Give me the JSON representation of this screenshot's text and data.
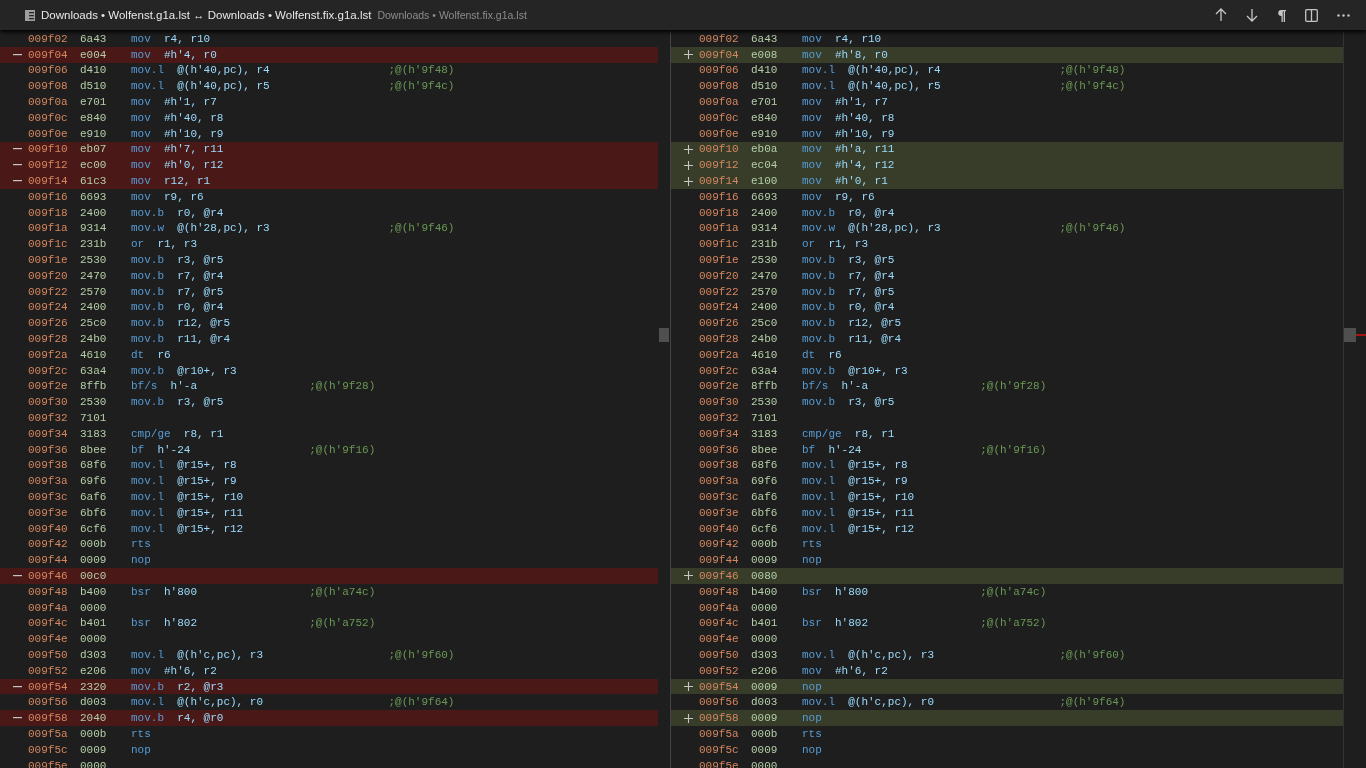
{
  "title": {
    "name": "Downloads • Wolfenst.g1a.lst ↔ Downloads • Wolfenst.fix.g1a.lst",
    "description": "Downloads • Wolfenst.fix.g1a.lst"
  },
  "panes": [
    {
      "lines": [
        {
          "kind": "unchanged",
          "addr": "009f02",
          "opcode": "6a43",
          "mnemonic": "mov",
          "operands": "r4, r10"
        },
        {
          "kind": "removed",
          "addr": "009f04",
          "opcode": "e004",
          "mnemonic": "mov",
          "operands": "#h'4, r0"
        },
        {
          "kind": "unchanged",
          "addr": "009f06",
          "opcode": "d410",
          "mnemonic": "mov.l",
          "operands": "@(h'40,pc), r4",
          "comment": ";@(h'9f48)"
        },
        {
          "kind": "unchanged",
          "addr": "009f08",
          "opcode": "d510",
          "mnemonic": "mov.l",
          "operands": "@(h'40,pc), r5",
          "comment": ";@(h'9f4c)"
        },
        {
          "kind": "unchanged",
          "addr": "009f0a",
          "opcode": "e701",
          "mnemonic": "mov",
          "operands": "#h'1, r7"
        },
        {
          "kind": "unchanged",
          "addr": "009f0c",
          "opcode": "e840",
          "mnemonic": "mov",
          "operands": "#h'40, r8"
        },
        {
          "kind": "unchanged",
          "addr": "009f0e",
          "opcode": "e910",
          "mnemonic": "mov",
          "operands": "#h'10, r9"
        },
        {
          "kind": "removed",
          "addr": "009f10",
          "opcode": "eb07",
          "mnemonic": "mov",
          "operands": "#h'7, r11"
        },
        {
          "kind": "removed",
          "addr": "009f12",
          "opcode": "ec00",
          "mnemonic": "mov",
          "operands": "#h'0, r12"
        },
        {
          "kind": "removed",
          "addr": "009f14",
          "opcode": "61c3",
          "mnemonic": "mov",
          "operands": "r12, r1"
        },
        {
          "kind": "unchanged",
          "addr": "009f16",
          "opcode": "6693",
          "mnemonic": "mov",
          "operands": "r9, r6"
        },
        {
          "kind": "unchanged",
          "addr": "009f18",
          "opcode": "2400",
          "mnemonic": "mov.b",
          "operands": "r0, @r4"
        },
        {
          "kind": "unchanged",
          "addr": "009f1a",
          "opcode": "9314",
          "mnemonic": "mov.w",
          "operands": "@(h'28,pc), r3",
          "comment": ";@(h'9f46)"
        },
        {
          "kind": "unchanged",
          "addr": "009f1c",
          "opcode": "231b",
          "mnemonic": "or",
          "operands": "r1, r3"
        },
        {
          "kind": "unchanged",
          "addr": "009f1e",
          "opcode": "2530",
          "mnemonic": "mov.b",
          "operands": "r3, @r5"
        },
        {
          "kind": "unchanged",
          "addr": "009f20",
          "opcode": "2470",
          "mnemonic": "mov.b",
          "operands": "r7, @r4"
        },
        {
          "kind": "unchanged",
          "addr": "009f22",
          "opcode": "2570",
          "mnemonic": "mov.b",
          "operands": "r7, @r5"
        },
        {
          "kind": "unchanged",
          "addr": "009f24",
          "opcode": "2400",
          "mnemonic": "mov.b",
          "operands": "r0, @r4"
        },
        {
          "kind": "unchanged",
          "addr": "009f26",
          "opcode": "25c0",
          "mnemonic": "mov.b",
          "operands": "r12, @r5"
        },
        {
          "kind": "unchanged",
          "addr": "009f28",
          "opcode": "24b0",
          "mnemonic": "mov.b",
          "operands": "r11, @r4"
        },
        {
          "kind": "unchanged",
          "addr": "009f2a",
          "opcode": "4610",
          "mnemonic": "dt",
          "operands": "r6"
        },
        {
          "kind": "unchanged",
          "addr": "009f2c",
          "opcode": "63a4",
          "mnemonic": "mov.b",
          "operands": "@r10+, r3"
        },
        {
          "kind": "unchanged",
          "addr": "009f2e",
          "opcode": "8ffb",
          "mnemonic": "bf/s",
          "operands": "h'-a",
          "comment": ";@(h'9f28)"
        },
        {
          "kind": "unchanged",
          "addr": "009f30",
          "opcode": "2530",
          "mnemonic": "mov.b",
          "operands": "r3, @r5"
        },
        {
          "kind": "unchanged",
          "addr": "009f32",
          "opcode": "7101"
        },
        {
          "kind": "unchanged",
          "addr": "009f34",
          "opcode": "3183",
          "mnemonic": "cmp/ge",
          "operands": "r8, r1"
        },
        {
          "kind": "unchanged",
          "addr": "009f36",
          "opcode": "8bee",
          "mnemonic": "bf",
          "operands": "h'-24",
          "comment": ";@(h'9f16)"
        },
        {
          "kind": "unchanged",
          "addr": "009f38",
          "opcode": "68f6",
          "mnemonic": "mov.l",
          "operands": "@r15+, r8"
        },
        {
          "kind": "unchanged",
          "addr": "009f3a",
          "opcode": "69f6",
          "mnemonic": "mov.l",
          "operands": "@r15+, r9"
        },
        {
          "kind": "unchanged",
          "addr": "009f3c",
          "opcode": "6af6",
          "mnemonic": "mov.l",
          "operands": "@r15+, r10"
        },
        {
          "kind": "unchanged",
          "addr": "009f3e",
          "opcode": "6bf6",
          "mnemonic": "mov.l",
          "operands": "@r15+, r11"
        },
        {
          "kind": "unchanged",
          "addr": "009f40",
          "opcode": "6cf6",
          "mnemonic": "mov.l",
          "operands": "@r15+, r12"
        },
        {
          "kind": "unchanged",
          "addr": "009f42",
          "opcode": "000b",
          "mnemonic": "rts"
        },
        {
          "kind": "unchanged",
          "addr": "009f44",
          "opcode": "0009",
          "mnemonic": "nop"
        },
        {
          "kind": "removed",
          "addr": "009f46",
          "opcode": "00c0"
        },
        {
          "kind": "unchanged",
          "addr": "009f48",
          "opcode": "b400",
          "mnemonic": "bsr",
          "operands": "h'800",
          "comment": ";@(h'a74c)"
        },
        {
          "kind": "unchanged",
          "addr": "009f4a",
          "opcode": "0000"
        },
        {
          "kind": "unchanged",
          "addr": "009f4c",
          "opcode": "b401",
          "mnemonic": "bsr",
          "operands": "h'802",
          "comment": ";@(h'a752)"
        },
        {
          "kind": "unchanged",
          "addr": "009f4e",
          "opcode": "0000"
        },
        {
          "kind": "unchanged",
          "addr": "009f50",
          "opcode": "d303",
          "mnemonic": "mov.l",
          "operands": "@(h'c,pc), r3",
          "comment": ";@(h'9f60)"
        },
        {
          "kind": "unchanged",
          "addr": "009f52",
          "opcode": "e206",
          "mnemonic": "mov",
          "operands": "#h'6, r2"
        },
        {
          "kind": "removed",
          "addr": "009f54",
          "opcode": "2320",
          "mnemonic": "mov.b",
          "operands": "r2, @r3"
        },
        {
          "kind": "unchanged",
          "addr": "009f56",
          "opcode": "d003",
          "mnemonic": "mov.l",
          "operands": "@(h'c,pc), r0",
          "comment": ";@(h'9f64)"
        },
        {
          "kind": "removed",
          "addr": "009f58",
          "opcode": "2040",
          "mnemonic": "mov.b",
          "operands": "r4, @r0"
        },
        {
          "kind": "unchanged",
          "addr": "009f5a",
          "opcode": "000b",
          "mnemonic": "rts"
        },
        {
          "kind": "unchanged",
          "addr": "009f5c",
          "opcode": "0009",
          "mnemonic": "nop"
        },
        {
          "kind": "unchanged",
          "addr": "009f5e",
          "opcode": "0000"
        }
      ]
    },
    {
      "lines": [
        {
          "kind": "unchanged",
          "addr": "009f02",
          "opcode": "6a43",
          "mnemonic": "mov",
          "operands": "r4, r10"
        },
        {
          "kind": "added",
          "addr": "009f04",
          "opcode": "e008",
          "mnemonic": "mov",
          "operands": "#h'8, r0"
        },
        {
          "kind": "unchanged",
          "addr": "009f06",
          "opcode": "d410",
          "mnemonic": "mov.l",
          "operands": "@(h'40,pc), r4",
          "comment": ";@(h'9f48)"
        },
        {
          "kind": "unchanged",
          "addr": "009f08",
          "opcode": "d510",
          "mnemonic": "mov.l",
          "operands": "@(h'40,pc), r5",
          "comment": ";@(h'9f4c)"
        },
        {
          "kind": "unchanged",
          "addr": "009f0a",
          "opcode": "e701",
          "mnemonic": "mov",
          "operands": "#h'1, r7"
        },
        {
          "kind": "unchanged",
          "addr": "009f0c",
          "opcode": "e840",
          "mnemonic": "mov",
          "operands": "#h'40, r8"
        },
        {
          "kind": "unchanged",
          "addr": "009f0e",
          "opcode": "e910",
          "mnemonic": "mov",
          "operands": "#h'10, r9"
        },
        {
          "kind": "added",
          "addr": "009f10",
          "opcode": "eb0a",
          "mnemonic": "mov",
          "operands": "#h'a, r11"
        },
        {
          "kind": "added",
          "addr": "009f12",
          "opcode": "ec04",
          "mnemonic": "mov",
          "operands": "#h'4, r12"
        },
        {
          "kind": "added",
          "addr": "009f14",
          "opcode": "e100",
          "mnemonic": "mov",
          "operands": "#h'0, r1"
        },
        {
          "kind": "unchanged",
          "addr": "009f16",
          "opcode": "6693",
          "mnemonic": "mov",
          "operands": "r9, r6"
        },
        {
          "kind": "unchanged",
          "addr": "009f18",
          "opcode": "2400",
          "mnemonic": "mov.b",
          "operands": "r0, @r4"
        },
        {
          "kind": "unchanged",
          "addr": "009f1a",
          "opcode": "9314",
          "mnemonic": "mov.w",
          "operands": "@(h'28,pc), r3",
          "comment": ";@(h'9f46)"
        },
        {
          "kind": "unchanged",
          "addr": "009f1c",
          "opcode": "231b",
          "mnemonic": "or",
          "operands": "r1, r3"
        },
        {
          "kind": "unchanged",
          "addr": "009f1e",
          "opcode": "2530",
          "mnemonic": "mov.b",
          "operands": "r3, @r5"
        },
        {
          "kind": "unchanged",
          "addr": "009f20",
          "opcode": "2470",
          "mnemonic": "mov.b",
          "operands": "r7, @r4"
        },
        {
          "kind": "unchanged",
          "addr": "009f22",
          "opcode": "2570",
          "mnemonic": "mov.b",
          "operands": "r7, @r5"
        },
        {
          "kind": "unchanged",
          "addr": "009f24",
          "opcode": "2400",
          "mnemonic": "mov.b",
          "operands": "r0, @r4"
        },
        {
          "kind": "unchanged",
          "addr": "009f26",
          "opcode": "25c0",
          "mnemonic": "mov.b",
          "operands": "r12, @r5"
        },
        {
          "kind": "unchanged",
          "addr": "009f28",
          "opcode": "24b0",
          "mnemonic": "mov.b",
          "operands": "r11, @r4"
        },
        {
          "kind": "unchanged",
          "addr": "009f2a",
          "opcode": "4610",
          "mnemonic": "dt",
          "operands": "r6"
        },
        {
          "kind": "unchanged",
          "addr": "009f2c",
          "opcode": "63a4",
          "mnemonic": "mov.b",
          "operands": "@r10+, r3"
        },
        {
          "kind": "unchanged",
          "addr": "009f2e",
          "opcode": "8ffb",
          "mnemonic": "bf/s",
          "operands": "h'-a",
          "comment": ";@(h'9f28)"
        },
        {
          "kind": "unchanged",
          "addr": "009f30",
          "opcode": "2530",
          "mnemonic": "mov.b",
          "operands": "r3, @r5"
        },
        {
          "kind": "unchanged",
          "addr": "009f32",
          "opcode": "7101"
        },
        {
          "kind": "unchanged",
          "addr": "009f34",
          "opcode": "3183",
          "mnemonic": "cmp/ge",
          "operands": "r8, r1"
        },
        {
          "kind": "unchanged",
          "addr": "009f36",
          "opcode": "8bee",
          "mnemonic": "bf",
          "operands": "h'-24",
          "comment": ";@(h'9f16)"
        },
        {
          "kind": "unchanged",
          "addr": "009f38",
          "opcode": "68f6",
          "mnemonic": "mov.l",
          "operands": "@r15+, r8"
        },
        {
          "kind": "unchanged",
          "addr": "009f3a",
          "opcode": "69f6",
          "mnemonic": "mov.l",
          "operands": "@r15+, r9"
        },
        {
          "kind": "unchanged",
          "addr": "009f3c",
          "opcode": "6af6",
          "mnemonic": "mov.l",
          "operands": "@r15+, r10"
        },
        {
          "kind": "unchanged",
          "addr": "009f3e",
          "opcode": "6bf6",
          "mnemonic": "mov.l",
          "operands": "@r15+, r11"
        },
        {
          "kind": "unchanged",
          "addr": "009f40",
          "opcode": "6cf6",
          "mnemonic": "mov.l",
          "operands": "@r15+, r12"
        },
        {
          "kind": "unchanged",
          "addr": "009f42",
          "opcode": "000b",
          "mnemonic": "rts"
        },
        {
          "kind": "unchanged",
          "addr": "009f44",
          "opcode": "0009",
          "mnemonic": "nop"
        },
        {
          "kind": "added",
          "addr": "009f46",
          "opcode": "0080"
        },
        {
          "kind": "unchanged",
          "addr": "009f48",
          "opcode": "b400",
          "mnemonic": "bsr",
          "operands": "h'800",
          "comment": ";@(h'a74c)"
        },
        {
          "kind": "unchanged",
          "addr": "009f4a",
          "opcode": "0000"
        },
        {
          "kind": "unchanged",
          "addr": "009f4c",
          "opcode": "b401",
          "mnemonic": "bsr",
          "operands": "h'802",
          "comment": ";@(h'a752)"
        },
        {
          "kind": "unchanged",
          "addr": "009f4e",
          "opcode": "0000"
        },
        {
          "kind": "unchanged",
          "addr": "009f50",
          "opcode": "d303",
          "mnemonic": "mov.l",
          "operands": "@(h'c,pc), r3",
          "comment": ";@(h'9f60)"
        },
        {
          "kind": "unchanged",
          "addr": "009f52",
          "opcode": "e206",
          "mnemonic": "mov",
          "operands": "#h'6, r2"
        },
        {
          "kind": "added",
          "addr": "009f54",
          "opcode": "0009",
          "mnemonic": "nop"
        },
        {
          "kind": "unchanged",
          "addr": "009f56",
          "opcode": "d003",
          "mnemonic": "mov.l",
          "operands": "@(h'c,pc), r0",
          "comment": ";@(h'9f64)"
        },
        {
          "kind": "added",
          "addr": "009f58",
          "opcode": "0009",
          "mnemonic": "nop"
        },
        {
          "kind": "unchanged",
          "addr": "009f5a",
          "opcode": "000b",
          "mnemonic": "rts"
        },
        {
          "kind": "unchanged",
          "addr": "009f5c",
          "opcode": "0009",
          "mnemonic": "nop"
        },
        {
          "kind": "unchanged",
          "addr": "009f5e",
          "opcode": "0000"
        }
      ]
    }
  ]
}
